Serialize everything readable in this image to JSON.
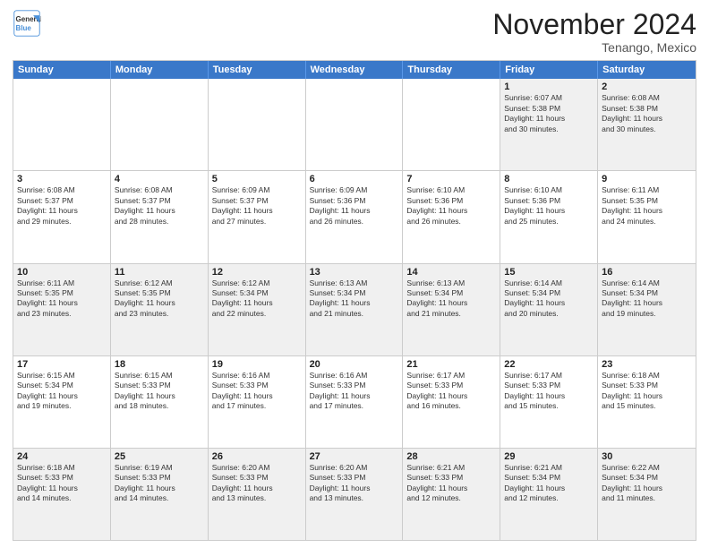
{
  "header": {
    "logo_line1": "General",
    "logo_line2": "Blue",
    "month": "November 2024",
    "location": "Tenango, Mexico"
  },
  "weekdays": [
    "Sunday",
    "Monday",
    "Tuesday",
    "Wednesday",
    "Thursday",
    "Friday",
    "Saturday"
  ],
  "rows": [
    [
      {
        "day": "",
        "info": ""
      },
      {
        "day": "",
        "info": ""
      },
      {
        "day": "",
        "info": ""
      },
      {
        "day": "",
        "info": ""
      },
      {
        "day": "",
        "info": ""
      },
      {
        "day": "1",
        "info": "Sunrise: 6:07 AM\nSunset: 5:38 PM\nDaylight: 11 hours\nand 30 minutes."
      },
      {
        "day": "2",
        "info": "Sunrise: 6:08 AM\nSunset: 5:38 PM\nDaylight: 11 hours\nand 30 minutes."
      }
    ],
    [
      {
        "day": "3",
        "info": "Sunrise: 6:08 AM\nSunset: 5:37 PM\nDaylight: 11 hours\nand 29 minutes."
      },
      {
        "day": "4",
        "info": "Sunrise: 6:08 AM\nSunset: 5:37 PM\nDaylight: 11 hours\nand 28 minutes."
      },
      {
        "day": "5",
        "info": "Sunrise: 6:09 AM\nSunset: 5:37 PM\nDaylight: 11 hours\nand 27 minutes."
      },
      {
        "day": "6",
        "info": "Sunrise: 6:09 AM\nSunset: 5:36 PM\nDaylight: 11 hours\nand 26 minutes."
      },
      {
        "day": "7",
        "info": "Sunrise: 6:10 AM\nSunset: 5:36 PM\nDaylight: 11 hours\nand 26 minutes."
      },
      {
        "day": "8",
        "info": "Sunrise: 6:10 AM\nSunset: 5:36 PM\nDaylight: 11 hours\nand 25 minutes."
      },
      {
        "day": "9",
        "info": "Sunrise: 6:11 AM\nSunset: 5:35 PM\nDaylight: 11 hours\nand 24 minutes."
      }
    ],
    [
      {
        "day": "10",
        "info": "Sunrise: 6:11 AM\nSunset: 5:35 PM\nDaylight: 11 hours\nand 23 minutes."
      },
      {
        "day": "11",
        "info": "Sunrise: 6:12 AM\nSunset: 5:35 PM\nDaylight: 11 hours\nand 23 minutes."
      },
      {
        "day": "12",
        "info": "Sunrise: 6:12 AM\nSunset: 5:34 PM\nDaylight: 11 hours\nand 22 minutes."
      },
      {
        "day": "13",
        "info": "Sunrise: 6:13 AM\nSunset: 5:34 PM\nDaylight: 11 hours\nand 21 minutes."
      },
      {
        "day": "14",
        "info": "Sunrise: 6:13 AM\nSunset: 5:34 PM\nDaylight: 11 hours\nand 21 minutes."
      },
      {
        "day": "15",
        "info": "Sunrise: 6:14 AM\nSunset: 5:34 PM\nDaylight: 11 hours\nand 20 minutes."
      },
      {
        "day": "16",
        "info": "Sunrise: 6:14 AM\nSunset: 5:34 PM\nDaylight: 11 hours\nand 19 minutes."
      }
    ],
    [
      {
        "day": "17",
        "info": "Sunrise: 6:15 AM\nSunset: 5:34 PM\nDaylight: 11 hours\nand 19 minutes."
      },
      {
        "day": "18",
        "info": "Sunrise: 6:15 AM\nSunset: 5:33 PM\nDaylight: 11 hours\nand 18 minutes."
      },
      {
        "day": "19",
        "info": "Sunrise: 6:16 AM\nSunset: 5:33 PM\nDaylight: 11 hours\nand 17 minutes."
      },
      {
        "day": "20",
        "info": "Sunrise: 6:16 AM\nSunset: 5:33 PM\nDaylight: 11 hours\nand 17 minutes."
      },
      {
        "day": "21",
        "info": "Sunrise: 6:17 AM\nSunset: 5:33 PM\nDaylight: 11 hours\nand 16 minutes."
      },
      {
        "day": "22",
        "info": "Sunrise: 6:17 AM\nSunset: 5:33 PM\nDaylight: 11 hours\nand 15 minutes."
      },
      {
        "day": "23",
        "info": "Sunrise: 6:18 AM\nSunset: 5:33 PM\nDaylight: 11 hours\nand 15 minutes."
      }
    ],
    [
      {
        "day": "24",
        "info": "Sunrise: 6:18 AM\nSunset: 5:33 PM\nDaylight: 11 hours\nand 14 minutes."
      },
      {
        "day": "25",
        "info": "Sunrise: 6:19 AM\nSunset: 5:33 PM\nDaylight: 11 hours\nand 14 minutes."
      },
      {
        "day": "26",
        "info": "Sunrise: 6:20 AM\nSunset: 5:33 PM\nDaylight: 11 hours\nand 13 minutes."
      },
      {
        "day": "27",
        "info": "Sunrise: 6:20 AM\nSunset: 5:33 PM\nDaylight: 11 hours\nand 13 minutes."
      },
      {
        "day": "28",
        "info": "Sunrise: 6:21 AM\nSunset: 5:33 PM\nDaylight: 11 hours\nand 12 minutes."
      },
      {
        "day": "29",
        "info": "Sunrise: 6:21 AM\nSunset: 5:34 PM\nDaylight: 11 hours\nand 12 minutes."
      },
      {
        "day": "30",
        "info": "Sunrise: 6:22 AM\nSunset: 5:34 PM\nDaylight: 11 hours\nand 11 minutes."
      }
    ]
  ]
}
